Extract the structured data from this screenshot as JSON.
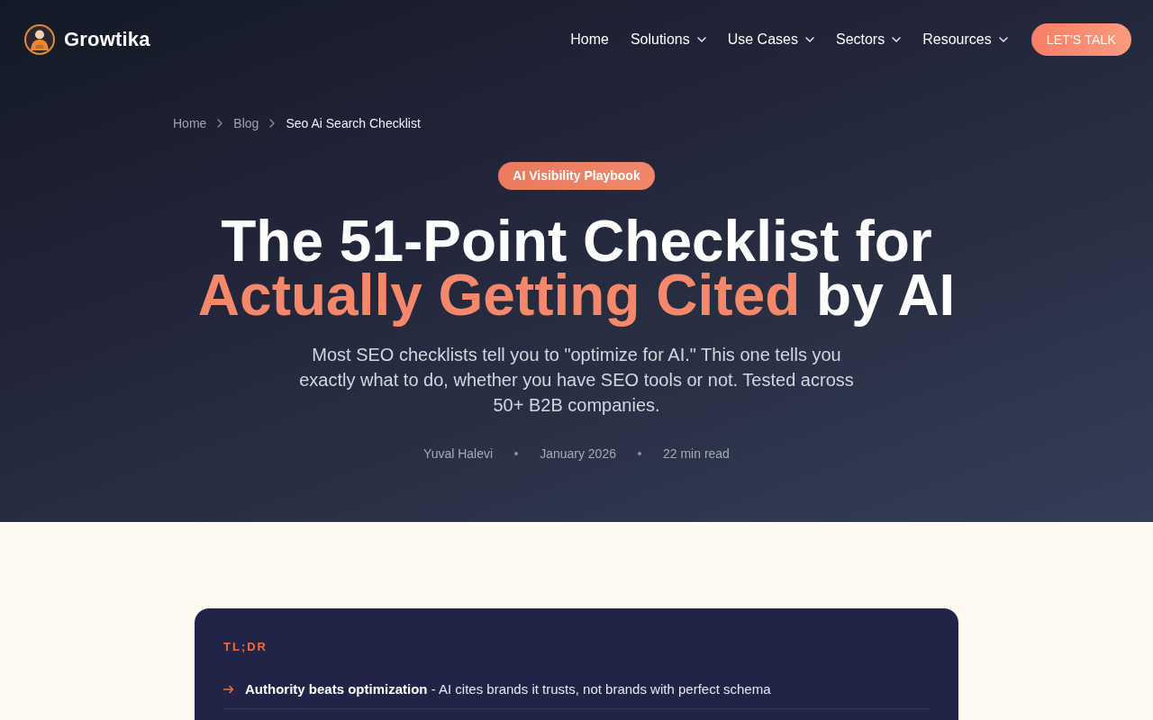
{
  "header": {
    "logo": "Growtika",
    "nav": [
      {
        "label": "Home",
        "has_menu": false
      },
      {
        "label": "Solutions",
        "has_menu": true
      },
      {
        "label": "Use Cases",
        "has_menu": true
      },
      {
        "label": "Sectors",
        "has_menu": true
      },
      {
        "label": "Resources",
        "has_menu": true
      }
    ],
    "cta": "LET'S TALK"
  },
  "hero": {
    "breadcrumb": [
      {
        "label": "Home",
        "current": false
      },
      {
        "label": "Blog",
        "current": false
      },
      {
        "label": "Seo Ai Search Checklist",
        "current": true
      }
    ],
    "badge": "AI Visibility Playbook",
    "title_lines": [
      [
        {
          "text": "The 51-Point Checklist for",
          "highlight": false
        }
      ],
      [
        {
          "text": "Actually Getting Cited",
          "highlight": true
        },
        {
          "text": "by AI",
          "highlight": false
        }
      ]
    ],
    "subtitle": "Most SEO checklists tell you to \"optimize for AI.\" This one tells you exactly what to do, whether you have SEO tools or not. Tested across 50+ B2B companies.",
    "meta": [
      "Yuval Halevi",
      "January 2026",
      "22 min read"
    ]
  },
  "tldr": {
    "label": "TL;DR",
    "items": [
      "**Authority beats optimization** - AI cites brands it trusts, not brands with perfect schema"
    ]
  }
}
